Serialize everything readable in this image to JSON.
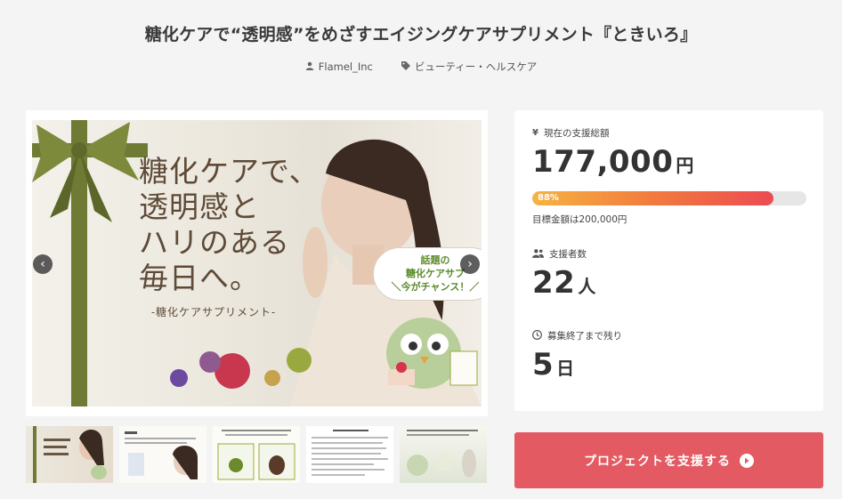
{
  "page": {
    "title": "糖化ケアで“透明感”をめざすエイジングケアサプリメント『ときいろ』",
    "author": "Flamel_Inc",
    "category": "ビューティー・ヘルスケア"
  },
  "hero": {
    "headline_lines": [
      "糖化ケアで、",
      "透明感と",
      "ハリのある",
      "毎日へ。"
    ],
    "subline": "-糖化ケアサプリメント-",
    "speech_lines": [
      "話題の",
      "糖化ケアサプ",
      "＼今がチャンス！／"
    ],
    "prev_glyph": "‹",
    "next_glyph": "›"
  },
  "thumbnails": [
    {
      "name": "slide-1"
    },
    {
      "name": "slide-2"
    },
    {
      "name": "slide-3"
    },
    {
      "name": "slide-4"
    },
    {
      "name": "slide-5"
    }
  ],
  "stats": {
    "raised_label": "現在の支援総額",
    "raised_amount": "177,000",
    "raised_unit": "円",
    "progress_percent": 88,
    "progress_label": "88%",
    "goal_text": "目標金額は200,000円",
    "backers_label": "支援者数",
    "backers_value": "22",
    "backers_unit": "人",
    "remaining_label": "募集終了まで残り",
    "remaining_value": "5",
    "remaining_unit": "日"
  },
  "cta": {
    "label": "プロジェクトを支援する"
  },
  "colors": {
    "accent": "#e35a62",
    "progress_start": "#f6b343",
    "progress_end": "#ec4b52"
  }
}
